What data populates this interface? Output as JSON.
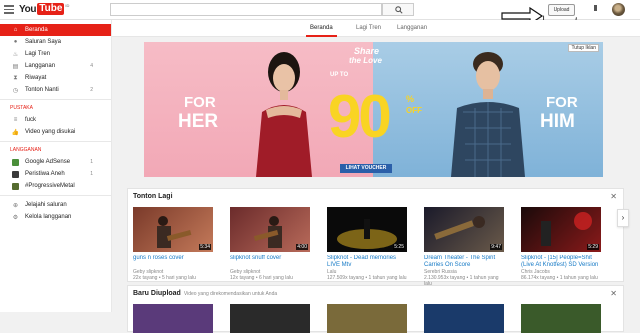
{
  "header": {
    "logo_you": "You",
    "logo_tube": "Tube",
    "logo_region": "ID",
    "search_placeholder": "",
    "upload_label": "Upload"
  },
  "sidebar": {
    "items": [
      {
        "label": "Beranda",
        "icon": "home-icon",
        "active": true,
        "count": ""
      },
      {
        "label": "Saluran Saya",
        "icon": "user-icon",
        "active": false,
        "count": ""
      },
      {
        "label": "Lagi Tren",
        "icon": "flame-icon",
        "active": false,
        "count": ""
      },
      {
        "label": "Langganan",
        "icon": "subscriptions-icon",
        "active": false,
        "count": "4"
      },
      {
        "label": "Riwayat",
        "icon": "hourglass-icon",
        "active": false,
        "count": ""
      },
      {
        "label": "Tonton Nanti",
        "icon": "clock-icon",
        "active": false,
        "count": "2"
      }
    ],
    "pustaka_header": "PUSTAKA",
    "pustaka": [
      {
        "label": "fuck",
        "icon": "list-icon"
      },
      {
        "label": "Video yang disukai",
        "icon": "thumbs-up-icon"
      }
    ],
    "langganan_header": "LANGGANAN",
    "subscriptions": [
      {
        "label": "Google AdSense",
        "count": "1",
        "color": "#4a8f3a"
      },
      {
        "label": "Peristiwa Aneh",
        "count": "1",
        "color": "#3a3a3a"
      },
      {
        "label": "#ProgressiveMetal",
        "count": "",
        "color": "#556b2f"
      }
    ],
    "bottom": [
      {
        "label": "Jelajahi saluran",
        "icon": "plus-circle-icon"
      },
      {
        "label": "Kelola langganan",
        "icon": "gear-icon"
      }
    ]
  },
  "tabs": [
    "Beranda",
    "Lagi Tren",
    "Langganan"
  ],
  "banner": {
    "for_her": "FOR\nHER",
    "for_her_1": "FOR",
    "for_her_2": "HER",
    "for_him_1": "FOR",
    "for_him_2": "HIM",
    "share_love": "Share\nthe Love",
    "share": "Share",
    "the_love": "the Love",
    "up_to": "UP TO",
    "ninety": "90",
    "percent": "%",
    "off": "OFF",
    "voucher": "LIHAT VOUCHER",
    "close_ad": "Tutup Iklan"
  },
  "section_watch": {
    "title": "Tonton Lagi",
    "videos": [
      {
        "title": "guns n roses cover",
        "channel": "Geby slipknot",
        "meta": "22x tayang  •  5 hari yang lalu",
        "duration": "5:34",
        "colors": [
          "#7a3a2a",
          "#c47a5a"
        ]
      },
      {
        "title": "slipknot snuff cover",
        "channel": "Geby slipknot",
        "meta": "12x tayang  •  6 hari yang lalu",
        "duration": "4:00",
        "colors": [
          "#6b2b2b",
          "#b86a5a"
        ]
      },
      {
        "title": "Slipknot - Dead memories LIVE Mtv",
        "channel": "Lalu",
        "meta": "127.509x tayang  •  1 tahun yang lalu",
        "duration": "5:25",
        "colors": [
          "#0a0a0a",
          "#c8a020"
        ]
      },
      {
        "title": "Dream Theater - The Spirit Carries On Score",
        "channel": "Serebri Russia",
        "meta": "2.130.953x tayang  •  1 tahun yang lalu",
        "duration": "9:47",
        "colors": [
          "#1a1a2a",
          "#6a5a4a"
        ]
      },
      {
        "title": "Slipknot - [15] People=Shit (Live At Knotfest) SD Version",
        "channel": "Chris Jacobs",
        "meta": "86.174x tayang  •  1 tahun yang lalu",
        "duration": "5:29",
        "colors": [
          "#1a0a0a",
          "#8a1a1a"
        ]
      }
    ]
  },
  "section_upload": {
    "title": "Baru Diupload",
    "subtitle": "Video yang direkomendasikan untuk Anda"
  },
  "next_arrow": "›",
  "close_glyph": "✕"
}
